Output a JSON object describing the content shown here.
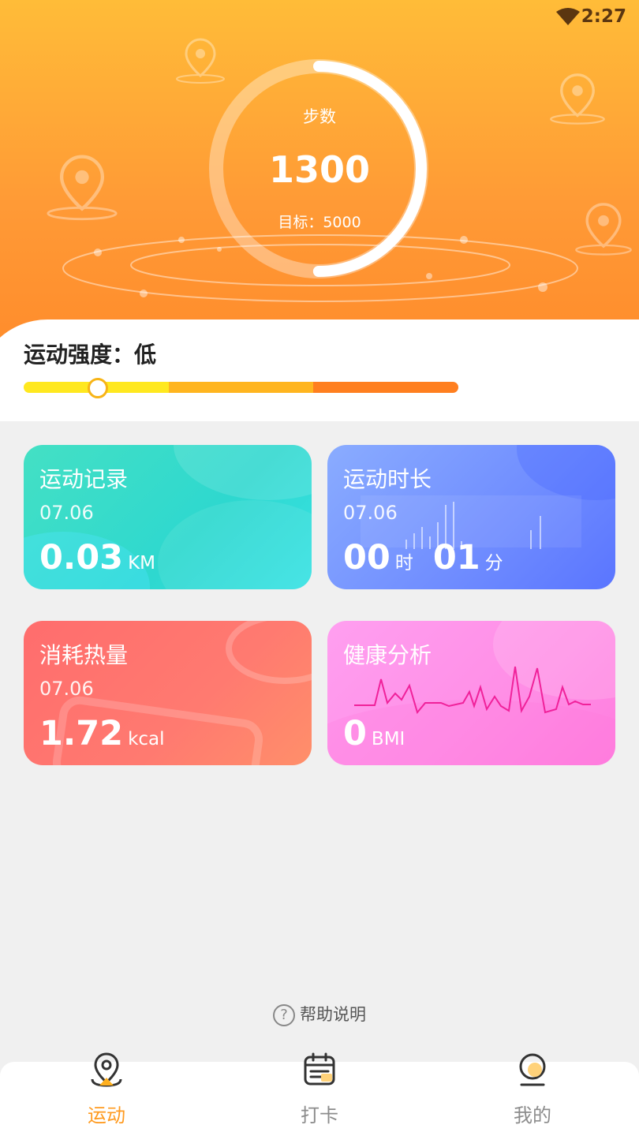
{
  "status_bar": {
    "time": "2:27"
  },
  "steps": {
    "label": "步数",
    "value": "1300",
    "goal": "目标：5000",
    "progress": 0.26
  },
  "intensity": {
    "label": "运动强度：低",
    "level": 0.17
  },
  "cards": [
    {
      "title": "运动记录",
      "date": "07.06",
      "value": "0.03",
      "unit": "KM"
    },
    {
      "title": "运动时长",
      "date": "07.06",
      "hours": "00",
      "hours_unit": "时",
      "minutes": "01",
      "minutes_unit": "分"
    },
    {
      "title": "消耗热量",
      "date": "07.06",
      "value": "1.72",
      "unit": "kcal"
    },
    {
      "title": "健康分析",
      "value": "0",
      "unit": "BMI"
    }
  ],
  "help": {
    "icon": "question-circle-icon",
    "label": "帮助说明"
  },
  "tabs": [
    {
      "label": "运动",
      "icon": "sport-location-icon",
      "active": true
    },
    {
      "label": "打卡",
      "icon": "calendar-checkin-icon",
      "active": false
    },
    {
      "label": "我的",
      "icon": "profile-icon",
      "active": false
    }
  ],
  "colors": {
    "accent": "#ff9a1f",
    "header_top": "#ffbc38",
    "header_bottom": "#ff8a2a",
    "card_record": "#2ed8cf",
    "card_duration": "#6f8cff",
    "card_calories": "#ff7a70",
    "card_health": "#ff8ee6"
  }
}
